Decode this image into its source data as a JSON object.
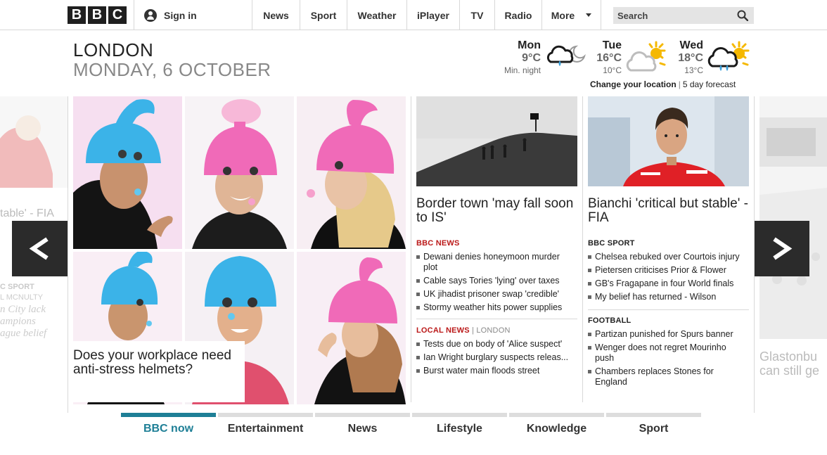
{
  "header": {
    "logo_letters": [
      "B",
      "B",
      "C"
    ],
    "sign_in": "Sign in",
    "nav": [
      {
        "label": "News"
      },
      {
        "label": "Sport"
      },
      {
        "label": "Weather"
      },
      {
        "label": "iPlayer"
      },
      {
        "label": "TV"
      },
      {
        "label": "Radio"
      },
      {
        "label": "More"
      }
    ],
    "search_placeholder": "Search"
  },
  "location": {
    "city": "LONDON",
    "date": "MONDAY, 6 OCTOBER"
  },
  "weather": {
    "days": [
      {
        "day": "Mon",
        "high": "9°C",
        "low": "Min. night",
        "icon": "cloud-rain-moon-icon"
      },
      {
        "day": "Tue",
        "high": "16°C",
        "low": "10°C",
        "icon": "cloud-sun-icon"
      },
      {
        "day": "Wed",
        "high": "18°C",
        "low": "13°C",
        "icon": "cloud-sun-rain-icon"
      }
    ],
    "change_location": "Change your location",
    "forecast_link": "5 day forecast"
  },
  "carousel": {
    "prev_icon": "chevron-left-icon",
    "next_icon": "chevron-right-icon",
    "left_ghost": {
      "headline_fragment": "table' - FIA",
      "label": "C SPORT",
      "sub": "L MCNULTY",
      "teaser": [
        "n City lack",
        "ampions",
        "ague belief"
      ]
    },
    "right_ghost": {
      "teaser": [
        "Glastonbu",
        "can still ge"
      ]
    }
  },
  "hero": {
    "caption": "Does your workplace need anti-stress helmets?"
  },
  "news_column": {
    "headline": "Border town 'may fall soon to IS'",
    "section_label": "BBC NEWS",
    "links": [
      "Dewani denies honeymoon murder plot",
      "Cable says Tories 'lying' over taxes",
      "UK jihadist prisoner swap 'credible'",
      "Stormy weather hits power supplies"
    ],
    "local_label": "LOCAL NEWS",
    "local_sub": "LONDON",
    "local_links": [
      "Tests due on body of 'Alice suspect'",
      "Ian Wright burglary suspects releas...",
      "Burst water main floods street"
    ]
  },
  "sport_column": {
    "headline": "Bianchi 'critical but stable' - FIA",
    "section_label": "BBC SPORT",
    "links": [
      "Chelsea rebuked over Courtois injury",
      "Pietersen criticises Prior & Flower",
      "GB's Fragapane in four World finals",
      "My belief has returned - Wilson"
    ],
    "football_label": "FOOTBALL",
    "football_links": [
      "Partizan punished for Spurs banner",
      "Wenger does not regret Mourinho push",
      "Chambers replaces Stones for England"
    ]
  },
  "tabs": [
    {
      "label": "BBC now"
    },
    {
      "label": "Entertainment"
    },
    {
      "label": "News"
    },
    {
      "label": "Lifestyle"
    },
    {
      "label": "Knowledge"
    },
    {
      "label": "Sport"
    }
  ],
  "colors": {
    "accent_teal": "#1e7f96",
    "news_red": "#bb1919",
    "helmet_blue": "#3bb3e8",
    "helmet_pink": "#f06ab8"
  }
}
